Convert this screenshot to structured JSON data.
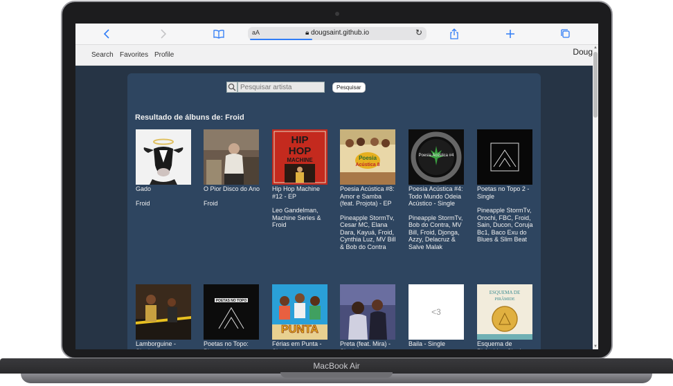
{
  "device": {
    "model_label": "MacBook Air"
  },
  "browser": {
    "url_prefix": "aA",
    "url": "dougsaint.github.io",
    "icons": [
      "back-icon",
      "forward-icon",
      "bookmarks-icon",
      "reload-icon",
      "share-icon",
      "new-tab-icon",
      "tabs-icon"
    ]
  },
  "nav": {
    "links": [
      "Search",
      "Favorites",
      "Profile"
    ],
    "brand": "Doug"
  },
  "search": {
    "placeholder": "Pesquisar artista",
    "button_label": "Pesquisar"
  },
  "results": {
    "title": "Resultado de álbuns de: Froid",
    "albums": [
      {
        "title": "Gado",
        "artist": "Froid"
      },
      {
        "title": "O Pior Disco do Ano",
        "artist": "Froid"
      },
      {
        "title": "Hip Hop Machine #12 - EP",
        "artist": "Leo Gandelman, Machine Series & Froid",
        "cover_text": "HIP HOP MACHINE"
      },
      {
        "title": "Poesia Acústica #8: Amor e Samba (feat. Projota) - EP",
        "artist": "Pineapple StormTv, Cesar MC, Elana Dara, Kayuá, Froid, Cynthia Luz, MV Bill & Bob do Contra",
        "cover_text": "Poesia Acústica 8"
      },
      {
        "title": "Poesia Acústica #4: Todo Mundo Odeia Acústico - Single",
        "artist": "Pineapple StormTv, Bob do Contra, MV Bill, Froid, Djonga, Azzy, Delacruz & Salve Malak",
        "cover_text": "Poesia Acústica #4"
      },
      {
        "title": "Poetas no Topo 2 - Single",
        "artist": "Pineapple StormTv, Orochi, FBC, Froid, Sain, Ducon, Coruja Bc1, Baco Exu do Blues & Slim Beat"
      },
      {
        "title": "Lamborguine - Single",
        "artist": ""
      },
      {
        "title": "Poetas no Topo: Pineapple",
        "artist": "",
        "cover_text": "POETAS NO TOPO"
      },
      {
        "title": "Férias em Punta - Single",
        "artist": "",
        "cover_text": "PUNTA"
      },
      {
        "title": "Preta (feat. Mira) - Single",
        "artist": ""
      },
      {
        "title": "Baila - Single",
        "artist": "",
        "cover_text": "<3"
      },
      {
        "title": "Esquema de Pirâmide - Single",
        "artist": "",
        "cover_text": "ESQUEMA DE PIRÂMIDE"
      }
    ]
  }
}
